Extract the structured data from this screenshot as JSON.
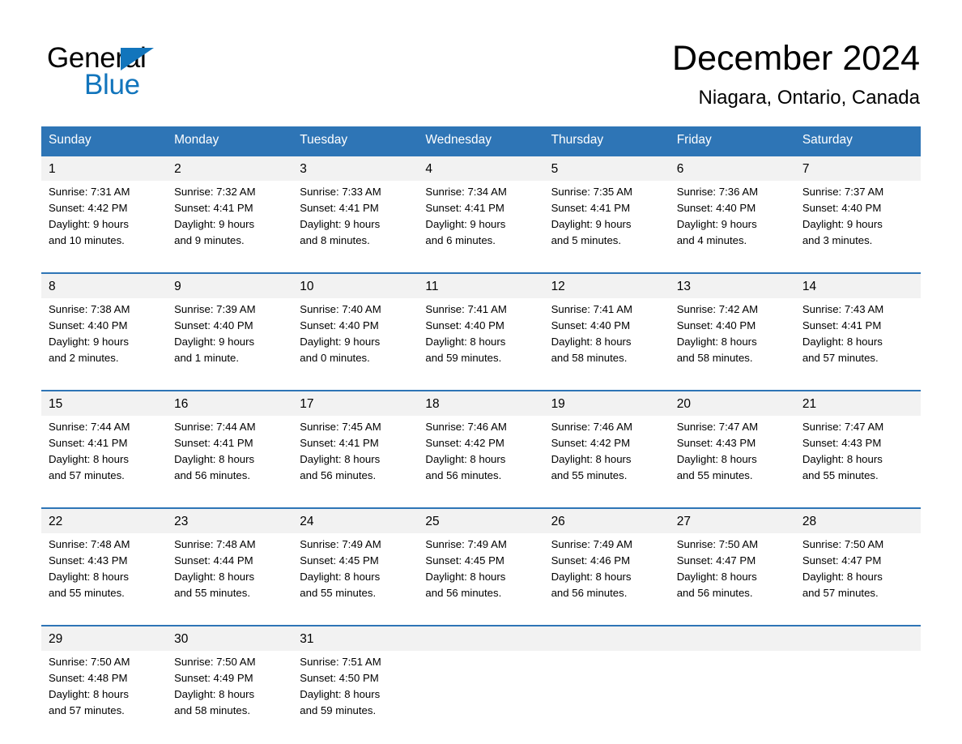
{
  "brand": {
    "name_part1": "General",
    "name_part2": "Blue",
    "triangle_color": "#1275bc"
  },
  "header": {
    "title": "December 2024",
    "location": "Niagara, Ontario, Canada",
    "header_bg": "#2e75b6",
    "daynum_bg": "#f2f2f2"
  },
  "weekdays": [
    "Sunday",
    "Monday",
    "Tuesday",
    "Wednesday",
    "Thursday",
    "Friday",
    "Saturday"
  ],
  "weeks": [
    {
      "days": [
        {
          "num": "1",
          "sunrise": "Sunrise: 7:31 AM",
          "sunset": "Sunset: 4:42 PM",
          "daylight_1": "Daylight: 9 hours",
          "daylight_2": "and 10 minutes."
        },
        {
          "num": "2",
          "sunrise": "Sunrise: 7:32 AM",
          "sunset": "Sunset: 4:41 PM",
          "daylight_1": "Daylight: 9 hours",
          "daylight_2": "and 9 minutes."
        },
        {
          "num": "3",
          "sunrise": "Sunrise: 7:33 AM",
          "sunset": "Sunset: 4:41 PM",
          "daylight_1": "Daylight: 9 hours",
          "daylight_2": "and 8 minutes."
        },
        {
          "num": "4",
          "sunrise": "Sunrise: 7:34 AM",
          "sunset": "Sunset: 4:41 PM",
          "daylight_1": "Daylight: 9 hours",
          "daylight_2": "and 6 minutes."
        },
        {
          "num": "5",
          "sunrise": "Sunrise: 7:35 AM",
          "sunset": "Sunset: 4:41 PM",
          "daylight_1": "Daylight: 9 hours",
          "daylight_2": "and 5 minutes."
        },
        {
          "num": "6",
          "sunrise": "Sunrise: 7:36 AM",
          "sunset": "Sunset: 4:40 PM",
          "daylight_1": "Daylight: 9 hours",
          "daylight_2": "and 4 minutes."
        },
        {
          "num": "7",
          "sunrise": "Sunrise: 7:37 AM",
          "sunset": "Sunset: 4:40 PM",
          "daylight_1": "Daylight: 9 hours",
          "daylight_2": "and 3 minutes."
        }
      ]
    },
    {
      "days": [
        {
          "num": "8",
          "sunrise": "Sunrise: 7:38 AM",
          "sunset": "Sunset: 4:40 PM",
          "daylight_1": "Daylight: 9 hours",
          "daylight_2": "and 2 minutes."
        },
        {
          "num": "9",
          "sunrise": "Sunrise: 7:39 AM",
          "sunset": "Sunset: 4:40 PM",
          "daylight_1": "Daylight: 9 hours",
          "daylight_2": "and 1 minute."
        },
        {
          "num": "10",
          "sunrise": "Sunrise: 7:40 AM",
          "sunset": "Sunset: 4:40 PM",
          "daylight_1": "Daylight: 9 hours",
          "daylight_2": "and 0 minutes."
        },
        {
          "num": "11",
          "sunrise": "Sunrise: 7:41 AM",
          "sunset": "Sunset: 4:40 PM",
          "daylight_1": "Daylight: 8 hours",
          "daylight_2": "and 59 minutes."
        },
        {
          "num": "12",
          "sunrise": "Sunrise: 7:41 AM",
          "sunset": "Sunset: 4:40 PM",
          "daylight_1": "Daylight: 8 hours",
          "daylight_2": "and 58 minutes."
        },
        {
          "num": "13",
          "sunrise": "Sunrise: 7:42 AM",
          "sunset": "Sunset: 4:40 PM",
          "daylight_1": "Daylight: 8 hours",
          "daylight_2": "and 58 minutes."
        },
        {
          "num": "14",
          "sunrise": "Sunrise: 7:43 AM",
          "sunset": "Sunset: 4:41 PM",
          "daylight_1": "Daylight: 8 hours",
          "daylight_2": "and 57 minutes."
        }
      ]
    },
    {
      "days": [
        {
          "num": "15",
          "sunrise": "Sunrise: 7:44 AM",
          "sunset": "Sunset: 4:41 PM",
          "daylight_1": "Daylight: 8 hours",
          "daylight_2": "and 57 minutes."
        },
        {
          "num": "16",
          "sunrise": "Sunrise: 7:44 AM",
          "sunset": "Sunset: 4:41 PM",
          "daylight_1": "Daylight: 8 hours",
          "daylight_2": "and 56 minutes."
        },
        {
          "num": "17",
          "sunrise": "Sunrise: 7:45 AM",
          "sunset": "Sunset: 4:41 PM",
          "daylight_1": "Daylight: 8 hours",
          "daylight_2": "and 56 minutes."
        },
        {
          "num": "18",
          "sunrise": "Sunrise: 7:46 AM",
          "sunset": "Sunset: 4:42 PM",
          "daylight_1": "Daylight: 8 hours",
          "daylight_2": "and 56 minutes."
        },
        {
          "num": "19",
          "sunrise": "Sunrise: 7:46 AM",
          "sunset": "Sunset: 4:42 PM",
          "daylight_1": "Daylight: 8 hours",
          "daylight_2": "and 55 minutes."
        },
        {
          "num": "20",
          "sunrise": "Sunrise: 7:47 AM",
          "sunset": "Sunset: 4:43 PM",
          "daylight_1": "Daylight: 8 hours",
          "daylight_2": "and 55 minutes."
        },
        {
          "num": "21",
          "sunrise": "Sunrise: 7:47 AM",
          "sunset": "Sunset: 4:43 PM",
          "daylight_1": "Daylight: 8 hours",
          "daylight_2": "and 55 minutes."
        }
      ]
    },
    {
      "days": [
        {
          "num": "22",
          "sunrise": "Sunrise: 7:48 AM",
          "sunset": "Sunset: 4:43 PM",
          "daylight_1": "Daylight: 8 hours",
          "daylight_2": "and 55 minutes."
        },
        {
          "num": "23",
          "sunrise": "Sunrise: 7:48 AM",
          "sunset": "Sunset: 4:44 PM",
          "daylight_1": "Daylight: 8 hours",
          "daylight_2": "and 55 minutes."
        },
        {
          "num": "24",
          "sunrise": "Sunrise: 7:49 AM",
          "sunset": "Sunset: 4:45 PM",
          "daylight_1": "Daylight: 8 hours",
          "daylight_2": "and 55 minutes."
        },
        {
          "num": "25",
          "sunrise": "Sunrise: 7:49 AM",
          "sunset": "Sunset: 4:45 PM",
          "daylight_1": "Daylight: 8 hours",
          "daylight_2": "and 56 minutes."
        },
        {
          "num": "26",
          "sunrise": "Sunrise: 7:49 AM",
          "sunset": "Sunset: 4:46 PM",
          "daylight_1": "Daylight: 8 hours",
          "daylight_2": "and 56 minutes."
        },
        {
          "num": "27",
          "sunrise": "Sunrise: 7:50 AM",
          "sunset": "Sunset: 4:47 PM",
          "daylight_1": "Daylight: 8 hours",
          "daylight_2": "and 56 minutes."
        },
        {
          "num": "28",
          "sunrise": "Sunrise: 7:50 AM",
          "sunset": "Sunset: 4:47 PM",
          "daylight_1": "Daylight: 8 hours",
          "daylight_2": "and 57 minutes."
        }
      ]
    },
    {
      "days": [
        {
          "num": "29",
          "sunrise": "Sunrise: 7:50 AM",
          "sunset": "Sunset: 4:48 PM",
          "daylight_1": "Daylight: 8 hours",
          "daylight_2": "and 57 minutes."
        },
        {
          "num": "30",
          "sunrise": "Sunrise: 7:50 AM",
          "sunset": "Sunset: 4:49 PM",
          "daylight_1": "Daylight: 8 hours",
          "daylight_2": "and 58 minutes."
        },
        {
          "num": "31",
          "sunrise": "Sunrise: 7:51 AM",
          "sunset": "Sunset: 4:50 PM",
          "daylight_1": "Daylight: 8 hours",
          "daylight_2": "and 59 minutes."
        },
        {
          "num": "",
          "sunrise": "",
          "sunset": "",
          "daylight_1": "",
          "daylight_2": ""
        },
        {
          "num": "",
          "sunrise": "",
          "sunset": "",
          "daylight_1": "",
          "daylight_2": ""
        },
        {
          "num": "",
          "sunrise": "",
          "sunset": "",
          "daylight_1": "",
          "daylight_2": ""
        },
        {
          "num": "",
          "sunrise": "",
          "sunset": "",
          "daylight_1": "",
          "daylight_2": ""
        }
      ]
    }
  ]
}
